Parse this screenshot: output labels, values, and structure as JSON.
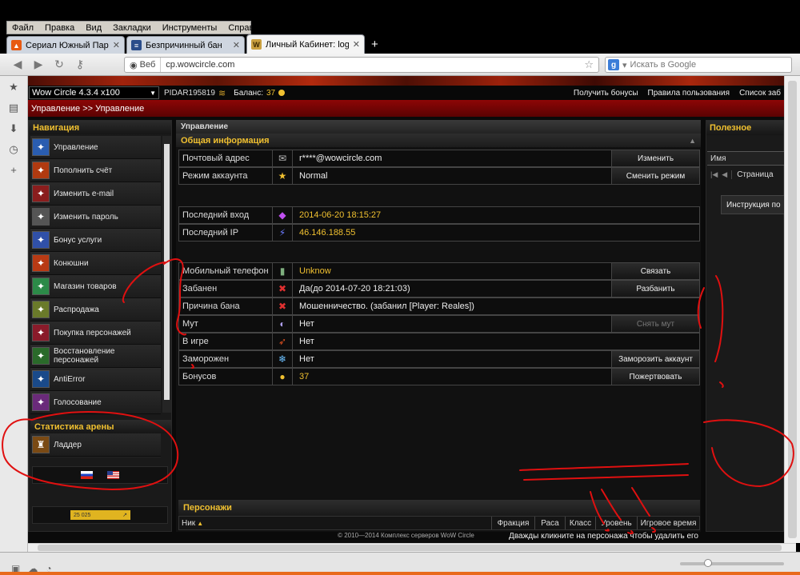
{
  "browser": {
    "menu": [
      "Файл",
      "Правка",
      "Вид",
      "Закладки",
      "Инструменты",
      "Справка"
    ],
    "tabs": [
      {
        "title": "Сериал Южный Парк ..."
      },
      {
        "title": "Безпричинный бан"
      },
      {
        "title": "Личный Кабинет: logo..."
      }
    ],
    "url_prefix": "Веб",
    "url": "cp.wowcircle.com",
    "search_placeholder": "Искать в Google"
  },
  "site": {
    "realm": "Wow Circle 4.3.4 x100",
    "account": "PIDAR195819",
    "balance_label": "Баланс:",
    "balance": "37",
    "top_links": [
      "Получить бонусы",
      "Правила пользования",
      "Список заб"
    ],
    "breadcrumb": "Управление >> Управление"
  },
  "nav": {
    "title": "Навигация",
    "items": [
      {
        "label": "Управление",
        "icon": "management-icon",
        "color": "#2a5db0"
      },
      {
        "label": "Пополнить счёт",
        "icon": "deposit-icon",
        "color": "#b03a10"
      },
      {
        "label": "Изменить e-mail",
        "icon": "email-icon",
        "color": "#8a1d1d"
      },
      {
        "label": "Изменить пароль",
        "icon": "password-icon",
        "color": "#555"
      },
      {
        "label": "Бонус услуги",
        "icon": "bonus-icon",
        "color": "#3050a8"
      },
      {
        "label": "Конюшни",
        "icon": "stables-icon",
        "color": "#b83a14"
      },
      {
        "label": "Магазин товаров",
        "icon": "shop-icon",
        "color": "#2c8a48"
      },
      {
        "label": "Распродажа",
        "icon": "sale-icon",
        "color": "#6a7a2a"
      },
      {
        "label": "Покупка персонажей",
        "icon": "buy-character-icon",
        "color": "#8a1b2a"
      },
      {
        "label": "Восстановление персонажей",
        "icon": "restore-character-icon",
        "color": "#2a6a2a"
      },
      {
        "label": "AntiError",
        "icon": "antierror-icon",
        "color": "#1a4a8a"
      },
      {
        "label": "Голосование",
        "icon": "vote-icon",
        "color": "#6a2a7a"
      }
    ]
  },
  "arena": {
    "title": "Статистика арены",
    "items": [
      {
        "label": "Ладдер",
        "icon": "ladder-icon"
      }
    ]
  },
  "counter": {
    "value": "25 025"
  },
  "main": {
    "title": "Управление",
    "section": "Общая информация",
    "rows": [
      {
        "label": "Почтовый адрес",
        "icon": "mail-icon",
        "value": "r****@wowcircle.com",
        "button": "Изменить"
      },
      {
        "label": "Режим аккаунта",
        "icon": "mode-icon",
        "value": "Normal",
        "button": "Сменить режим"
      },
      {
        "label": "Последний вход",
        "icon": "last-login-icon",
        "value": "2014-06-20 18:15:27"
      },
      {
        "label": "Последний IP",
        "icon": "last-ip-icon",
        "value": "46.146.188.55"
      },
      {
        "label": "Мобильный телефон",
        "icon": "phone-icon",
        "value": "Unknow",
        "button": "Связать"
      },
      {
        "label": "Забанен",
        "icon": "ban-icon",
        "value": "Да(до 2014-07-20 18:21:03)",
        "button": "Разбанить"
      },
      {
        "label": "Причина бана",
        "icon": "ban-reason-icon",
        "value": "Мошенничество. (забанил [Player: Reales])"
      },
      {
        "label": "Мут",
        "icon": "mute-icon",
        "value": "Нет",
        "button": "Снять мут"
      },
      {
        "label": "В игре",
        "icon": "ingame-icon",
        "value": "Нет"
      },
      {
        "label": "Заморожен",
        "icon": "frozen-icon",
        "value": "Нет",
        "button": "Заморозить аккаунт"
      },
      {
        "label": "Бонусов",
        "icon": "bonus-coin-icon",
        "value": "37",
        "button": "Пожертвовать"
      }
    ],
    "characters": {
      "title": "Персонажи",
      "columns": [
        "Ник",
        "Фракция",
        "Раса",
        "Класс",
        "Уровень",
        "Игровое время"
      ],
      "hint": "Дважды кликните на персонажа чтобы удалить его"
    }
  },
  "right": {
    "title": "Полезное",
    "name_col": "Имя",
    "pager": "Страница",
    "instruction": "Инструкция по"
  },
  "footer": "© 2010—2014 Комплекс серверов WoW Circle"
}
